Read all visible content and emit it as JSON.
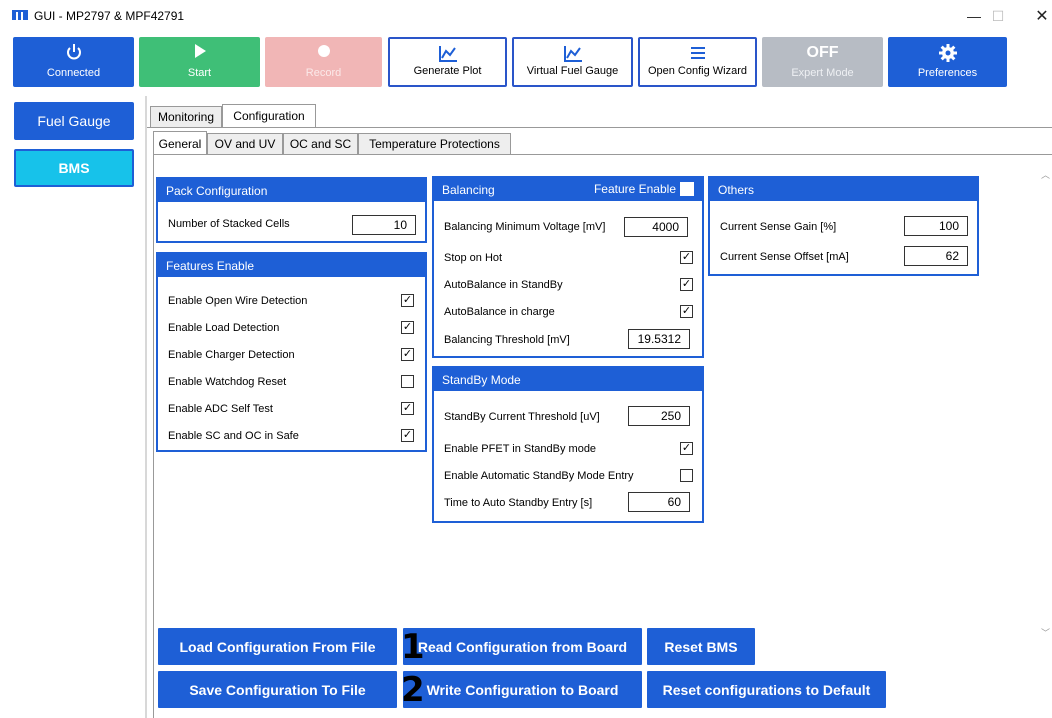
{
  "window": {
    "title": "GUI - MP2797 & MPF42791",
    "minimize": "—",
    "maximize": "☐",
    "close": "✕"
  },
  "toolbar": {
    "connected": "Connected",
    "start": "Start",
    "record": "Record",
    "generate_plot": "Generate Plot",
    "virtual_fuel_gauge": "Virtual Fuel Gauge",
    "open_config_wizard": "Open Config Wizard",
    "expert_mode_state": "OFF",
    "expert_mode": "Expert Mode",
    "preferences": "Preferences"
  },
  "sidebar": {
    "items": [
      {
        "label": "Fuel Gauge"
      },
      {
        "label": "BMS",
        "active": true
      }
    ]
  },
  "tabs": {
    "top": [
      {
        "label": "Monitoring"
      },
      {
        "label": "Configuration",
        "active": true
      }
    ],
    "sub": [
      {
        "label": "General",
        "active": true
      },
      {
        "label": "OV and UV"
      },
      {
        "label": "OC and SC"
      },
      {
        "label": "Temperature Protections"
      }
    ]
  },
  "pack_config": {
    "title": "Pack Configuration",
    "stacked_cells_label": "Number of Stacked Cells",
    "stacked_cells_value": "10"
  },
  "features": {
    "title": "Features Enable",
    "items": [
      {
        "label": "Enable Open Wire Detection",
        "checked": true
      },
      {
        "label": "Enable Load Detection",
        "checked": true
      },
      {
        "label": "Enable Charger Detection",
        "checked": true
      },
      {
        "label": "Enable Watchdog Reset",
        "checked": false
      },
      {
        "label": "Enable ADC Self Test",
        "checked": true
      },
      {
        "label": "Enable SC and OC in Safe",
        "checked": true
      }
    ]
  },
  "balancing": {
    "title": "Balancing",
    "feature_enable_label": "Feature Enable",
    "feature_enable_checked": false,
    "min_voltage_label": "Balancing Minimum Voltage [mV]",
    "min_voltage_value": "4000",
    "stop_on_hot_label": "Stop on Hot",
    "stop_on_hot_checked": true,
    "auto_standby_label": "AutoBalance in StandBy",
    "auto_standby_checked": true,
    "auto_charge_label": "AutoBalance in charge",
    "auto_charge_checked": true,
    "threshold_label": "Balancing Threshold [mV]",
    "threshold_value": "19.5312"
  },
  "standby": {
    "title": "StandBy Mode",
    "current_threshold_label": "StandBy Current Threshold [uV]",
    "current_threshold_value": "250",
    "pfet_label": "Enable PFET in StandBy mode",
    "pfet_checked": true,
    "auto_entry_label": "Enable Automatic StandBy Mode Entry",
    "auto_entry_checked": false,
    "time_label": "Time to Auto Standby Entry [s]",
    "time_value": "60"
  },
  "others": {
    "title": "Others",
    "gain_label": "Current Sense Gain [%]",
    "gain_value": "100",
    "offset_label": "Current Sense Offset [mA]",
    "offset_value": "62"
  },
  "actions": {
    "load_file": "Load Configuration From File",
    "read_board": "Read Configuration from Board",
    "reset_bms": "Reset BMS",
    "save_file": "Save Configuration To File",
    "write_board": "Write Configuration to Board",
    "reset_default": "Reset configurations to Default"
  },
  "markers": {
    "one": "1",
    "two": "2"
  },
  "colors": {
    "accent": "#1e5fd6",
    "start_green": "#3fbf77",
    "record_red": "#f1b6b6",
    "bms_cyan": "#17c2ea",
    "disabled_gray": "#b7bcc4"
  },
  "icons": {
    "connected": "power-icon",
    "start": "play-icon",
    "record": "record-icon",
    "generate_plot": "chart-line-icon",
    "virtual_fuel_gauge": "chart-line-icon",
    "open_config_wizard": "list-icon",
    "preferences": "gear-icon"
  }
}
